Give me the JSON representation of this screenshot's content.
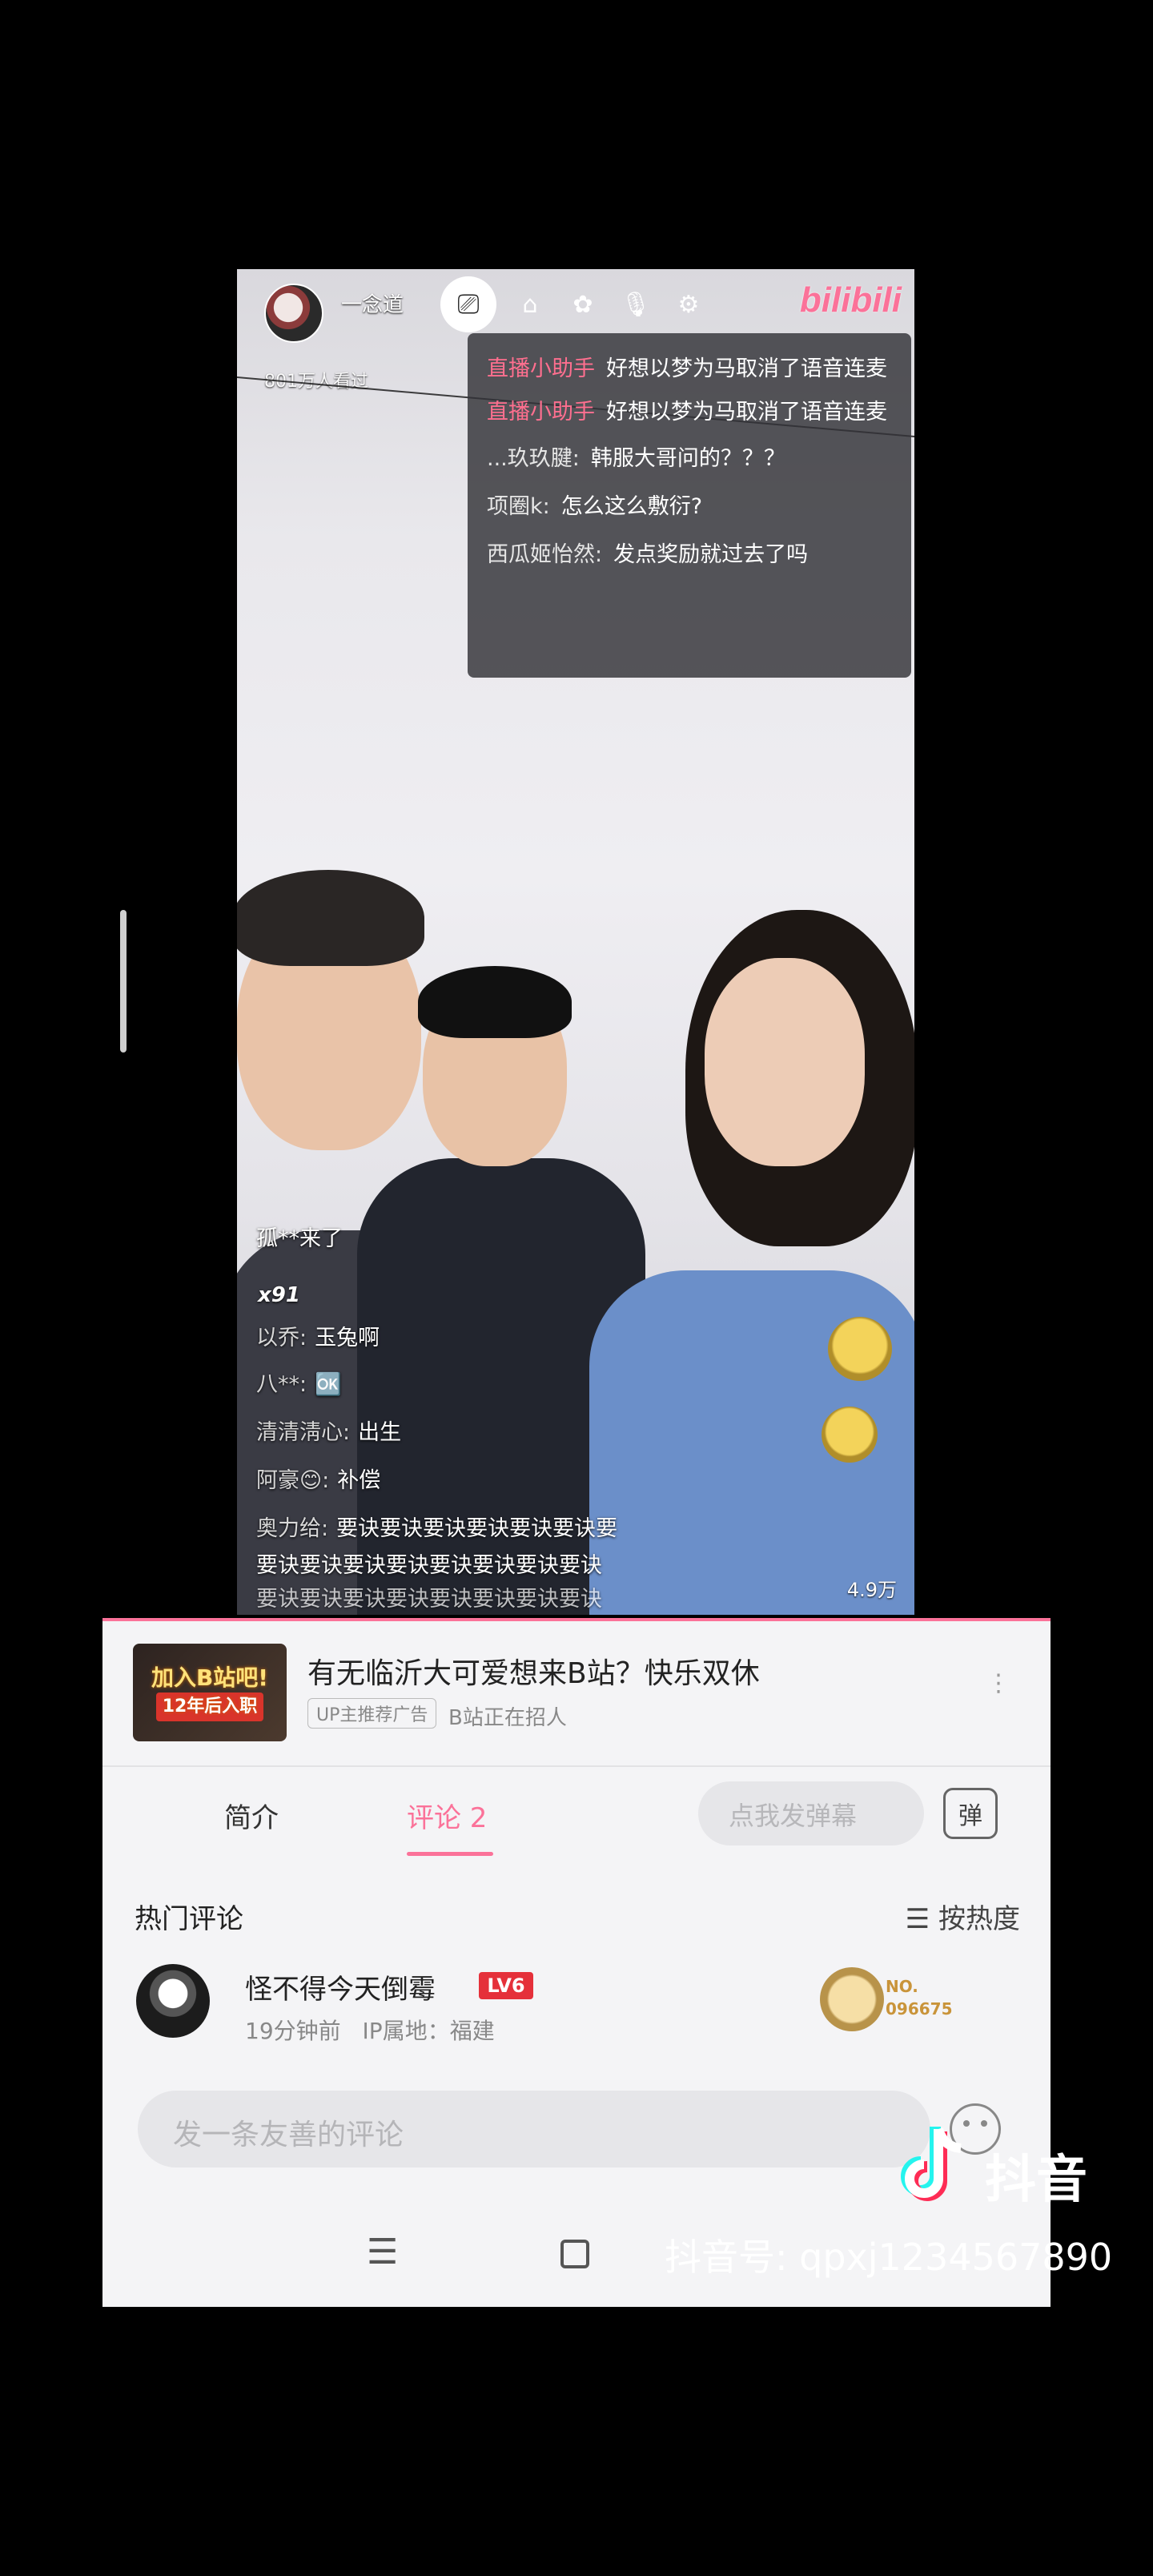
{
  "live": {
    "streamer_name": "一念道",
    "fans_text": "801万人看过",
    "logo": "bilibili",
    "icons": [
      "tv-icon",
      "home-icon",
      "gift-icon",
      "mic-icon",
      "settings-icon"
    ]
  },
  "chat": [
    {
      "user": "直播小助手",
      "text": "好想以梦为马取消了语音连麦",
      "accent": true
    },
    {
      "user": "直播小助手",
      "text": "好想以梦为马取消了语音连麦",
      "accent": true
    },
    {
      "user": "...玖玖腱:",
      "text": "韩服大哥问的？？？",
      "accent": false
    },
    {
      "user": "项圈k:",
      "text": "怎么这么敷衍?",
      "accent": false
    },
    {
      "user": "西瓜姬怡然:",
      "text": "发点奖励就过去了吗",
      "accent": false
    }
  ],
  "danmaku": {
    "line1": "孤**来了",
    "gift": "x91",
    "line2_name": "以乔:",
    "line2_text": "玉兔啊",
    "line3_name": "八**:",
    "line3_text": "🆗",
    "line4_name": "清清淸心:",
    "line4_text": "出生",
    "line5_name": "阿豪😊:",
    "line5_text": "补偿",
    "line6_name": "奥力给:",
    "line6_text": "要诀要诀要诀要诀要诀要诀要",
    "line7": "要诀要诀要诀要诀要诀要诀要诀要诀",
    "line8": "要诀要诀要诀要诀要诀要诀要诀要诀",
    "viewers": "4.9万"
  },
  "ad": {
    "thumb_line1": "加入B站吧!",
    "thumb_line2": "12年后入职",
    "title": "有无临沂大可爱想来B站？快乐双休",
    "tag": "UP主推荐广告",
    "sub": "B站正在招人"
  },
  "tabs": {
    "intro": "简介",
    "comments": "评论 2",
    "danmaku_placeholder": "点我发弹幕",
    "danmaku_toggle": "弹"
  },
  "comments": {
    "header": "热门评论",
    "sort": "☰ 按热度",
    "items": [
      {
        "user": "怪不得今天倒霉",
        "level": "LV6",
        "time": "19分钟前",
        "ip": "IP属地：福建",
        "badge_no": "NO.",
        "badge_num": "096675"
      }
    ],
    "reply_placeholder": "发一条友善的评论"
  },
  "nav": {
    "menu": "☰"
  },
  "watermark": {
    "brand": "抖音",
    "id": "抖音号: qpxj1234567890"
  },
  "colors": {
    "accent": "#fb7299",
    "level": "#e5303a"
  }
}
